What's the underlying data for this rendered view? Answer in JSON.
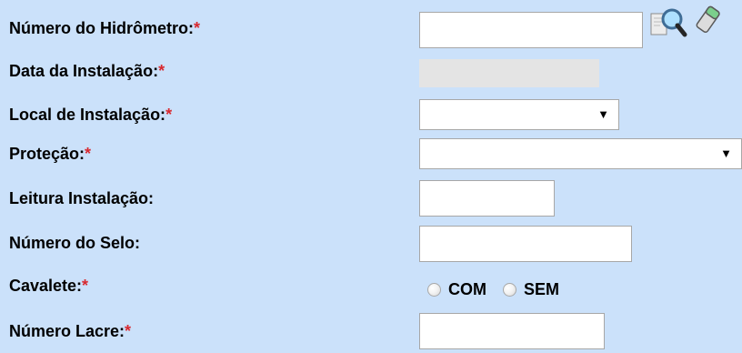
{
  "form": {
    "rows": [
      {
        "label": "Número do Hidrômetro:",
        "required": "*"
      },
      {
        "label": "Data da Instalação:",
        "required": "*"
      },
      {
        "label": "Local de Instalação:",
        "required": "*"
      },
      {
        "label": "Proteção:",
        "required": "*"
      },
      {
        "label": "Leitura Instalação:"
      },
      {
        "label": "Número do Selo:"
      },
      {
        "label": "Cavalete:",
        "required": "*"
      },
      {
        "label": "Número Lacre:",
        "required": "*"
      }
    ],
    "fields": {
      "hydrometer_number": "",
      "installation_date": "",
      "installation_location": "",
      "protection": "",
      "installation_reading": "",
      "seal_number": "",
      "lacre_number": ""
    },
    "radio": {
      "com": "COM",
      "sem": "SEM"
    },
    "icons": {
      "search": "magnifying-glass-document-icon",
      "eraser": "eraser-icon"
    },
    "dropdown_arrow": "▼"
  }
}
